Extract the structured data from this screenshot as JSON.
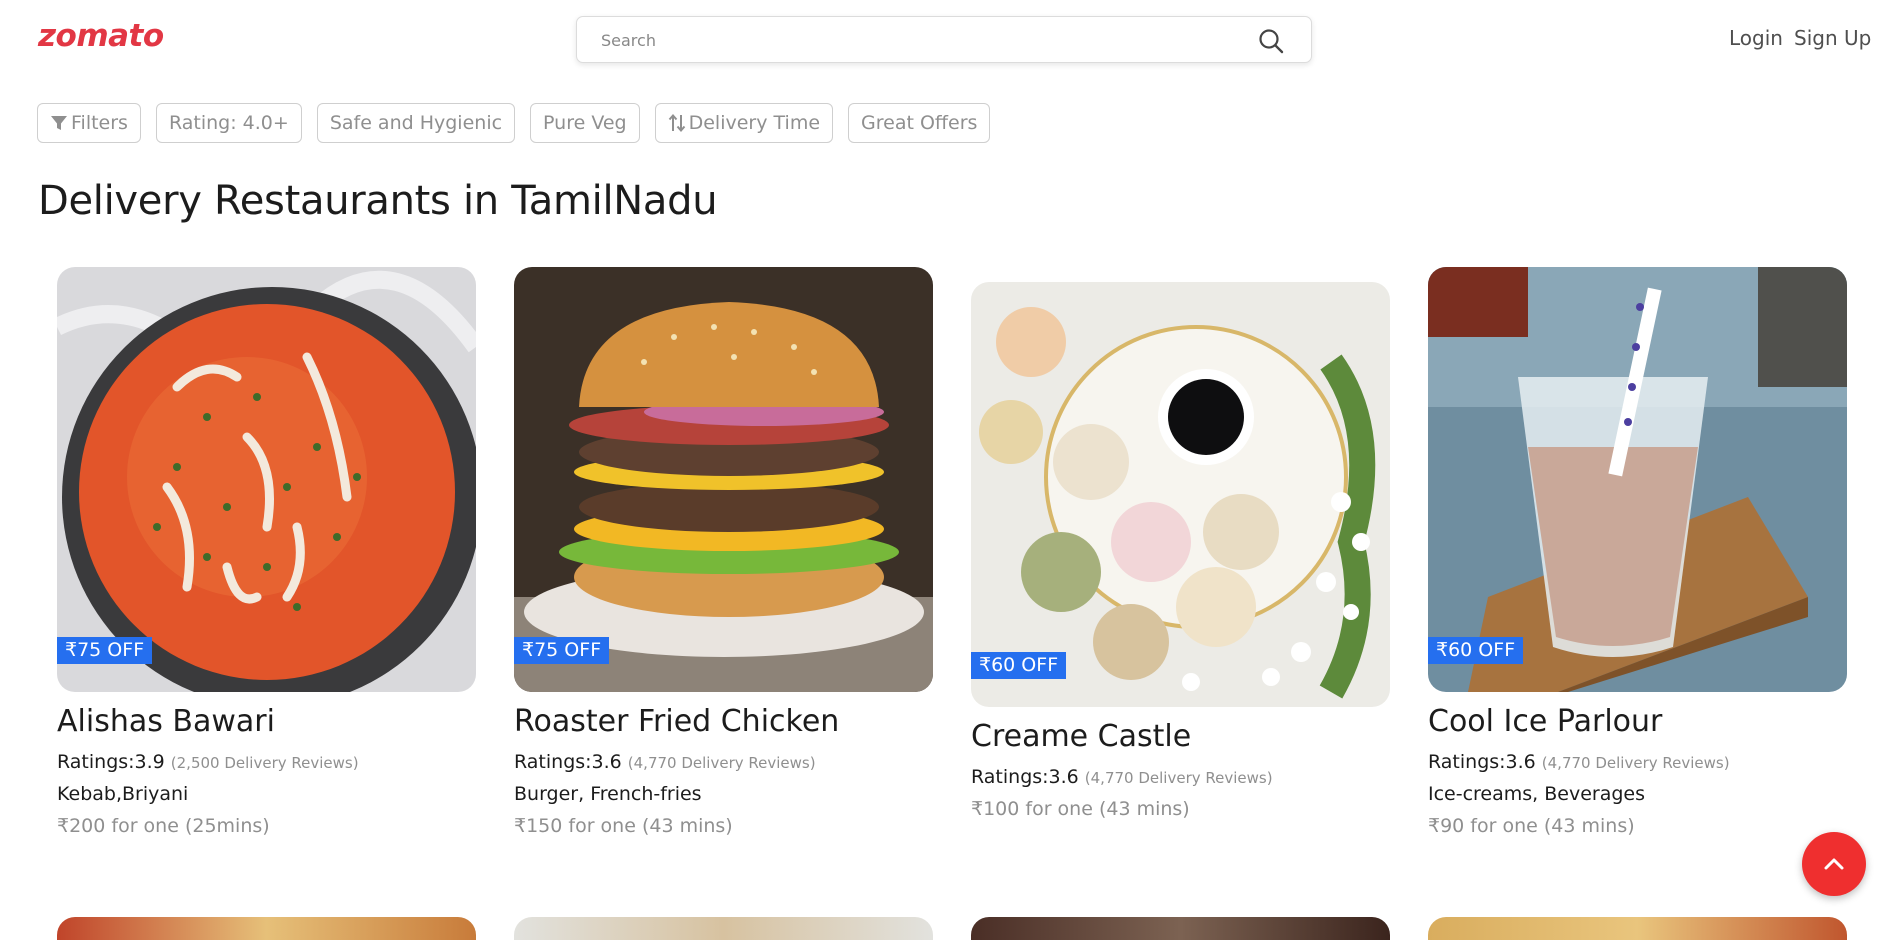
{
  "header": {
    "logo": "zomato",
    "search_placeholder": "Search",
    "login": "Login",
    "signup": "Sign Up"
  },
  "filters": {
    "filters": "Filters",
    "rating": "Rating: 4.0+",
    "safe": "Safe and Hygienic",
    "pure_veg": "Pure Veg",
    "delivery_time": "Delivery Time",
    "great_offers": "Great Offers"
  },
  "page_title": "Delivery Restaurants in TamilNadu",
  "restaurants": [
    {
      "name": "Alishas Bawari",
      "offer": "₹75 OFF",
      "rating": "Ratings:3.9",
      "reviews": "(2,500 Delivery Reviews)",
      "cuisine": "Kebab,Briyani",
      "price": "₹200 for one (25mins)",
      "image": "curry-bowl"
    },
    {
      "name": "Roaster Fried Chicken",
      "offer": "₹75 OFF",
      "rating": "Ratings:3.6",
      "reviews": "(4,770 Delivery Reviews)",
      "cuisine": "Burger, French-fries",
      "price": "₹150 for one (43 mins)",
      "image": "burger"
    },
    {
      "name": "Creame Castle",
      "offer": "₹60 OFF",
      "rating": "Ratings:3.6",
      "reviews": "(4,770 Delivery Reviews)",
      "cuisine": "",
      "price": "₹100 for one (43 mins)",
      "image": "macarons-coffee"
    },
    {
      "name": "Cool Ice Parlour",
      "offer": "₹60 OFF",
      "rating": "Ratings:3.6",
      "reviews": "(4,770 Delivery Reviews)",
      "cuisine": "Ice-creams, Beverages",
      "price": "₹90 for one (43 mins)",
      "image": "milkshake"
    }
  ],
  "colors": {
    "brand": "#e23744",
    "offer_badge": "#256fef",
    "scroll_button": "#ef2f2f"
  },
  "icons": {
    "search": "search-icon",
    "filter": "filter-icon",
    "sort": "sort-icon",
    "scroll_top": "chevron-up-icon"
  }
}
